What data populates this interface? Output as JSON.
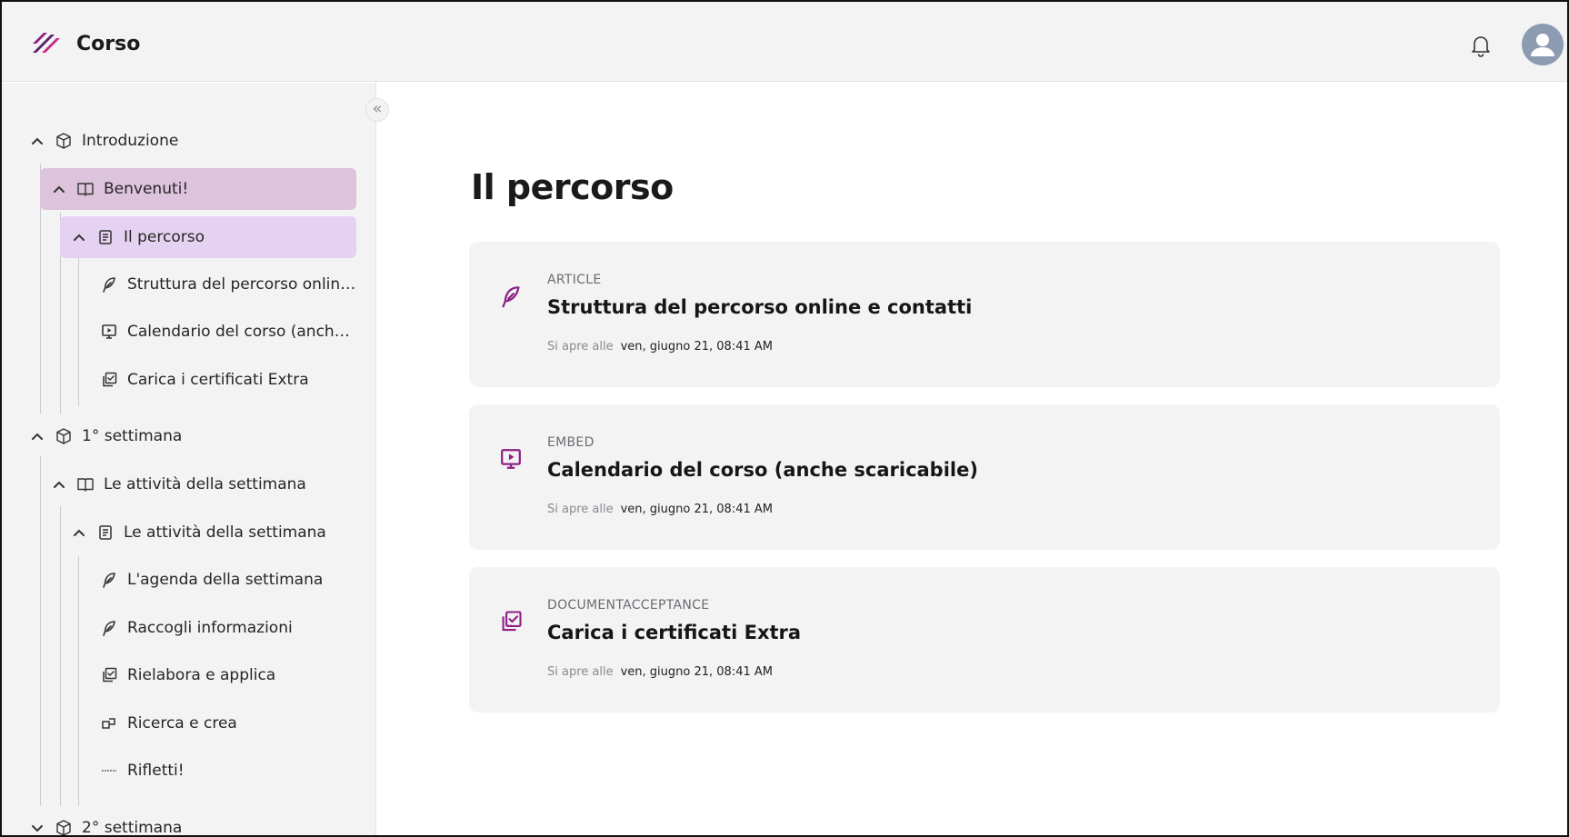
{
  "header": {
    "app_title": "Corso",
    "logo_icon": "zigzag-logo",
    "notification_icon": "bell-icon",
    "avatar_icon": "user-avatar-icon",
    "accent_color": "#8e1f86"
  },
  "sidebar": {
    "collapse_label": "«",
    "items": [
      {
        "label": "Introduzione",
        "icon": "cube-icon",
        "expanded": true
      },
      {
        "label": "Benvenuti!",
        "icon": "book-icon",
        "expanded": true,
        "selected": true
      },
      {
        "label": "Il percorso",
        "icon": "document-icon",
        "expanded": true,
        "selected": true
      },
      {
        "label": "Struttura del percorso online ...",
        "icon": "feather-icon"
      },
      {
        "label": "Calendario del corso (anche s...",
        "icon": "presentation-icon"
      },
      {
        "label": "Carica i certificati Extra",
        "icon": "checked-copy-icon"
      },
      {
        "label": "1° settimana",
        "icon": "cube-icon",
        "expanded": true
      },
      {
        "label": "Le attività della settimana",
        "icon": "book-icon",
        "expanded": true
      },
      {
        "label": "Le attività della settimana",
        "icon": "document-icon",
        "expanded": true
      },
      {
        "label": "L'agenda della settimana",
        "icon": "feather-icon"
      },
      {
        "label": "Raccogli informazioni",
        "icon": "feather-icon"
      },
      {
        "label": "Rielabora e applica",
        "icon": "checked-copy-icon"
      },
      {
        "label": "Ricerca e crea",
        "icon": "blocks-icon"
      },
      {
        "label": "Rifletti!",
        "icon": "divider-icon"
      },
      {
        "label": "2° settimana",
        "icon": "cube-icon",
        "expanded": false
      }
    ]
  },
  "main": {
    "title": "Il percorso",
    "cards": [
      {
        "type": "ARTICLE",
        "title": "Struttura del percorso online e contatti",
        "meta_label": "Si apre alle",
        "meta_value": "ven, giugno 21, 08:41 AM",
        "icon": "feather-icon"
      },
      {
        "type": "EMBED",
        "title": "Calendario del corso (anche scaricabile)",
        "meta_label": "Si apre alle",
        "meta_value": "ven, giugno 21, 08:41 AM",
        "icon": "presentation-icon"
      },
      {
        "type": "DOCUMENTACCEPTANCE",
        "title": "Carica i certificati Extra",
        "meta_label": "Si apre alle",
        "meta_value": "ven, giugno 21, 08:41 AM",
        "icon": "checked-copy-icon"
      }
    ]
  }
}
